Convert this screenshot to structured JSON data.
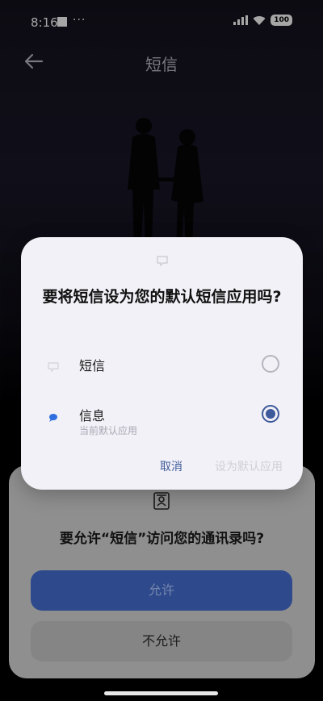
{
  "status_bar": {
    "time": "8:16",
    "dots": "···",
    "battery": "100"
  },
  "app_bar": {
    "title": "短信"
  },
  "dialog": {
    "title": "要将短信设为您的默认短信应用吗?",
    "options": [
      {
        "label": "短信",
        "sublabel": "",
        "selected": false
      },
      {
        "label": "信息",
        "sublabel": "当前默认应用",
        "selected": true
      }
    ],
    "cancel_label": "取消",
    "set_default_label": "设为默认应用"
  },
  "permission": {
    "question": "要允许“短信”访问您的通讯录吗?",
    "allow_label": "允许",
    "deny_label": "不允许"
  },
  "colors": {
    "accent": "#3d5a9a",
    "dialog_bg": "#f2f1f7"
  }
}
